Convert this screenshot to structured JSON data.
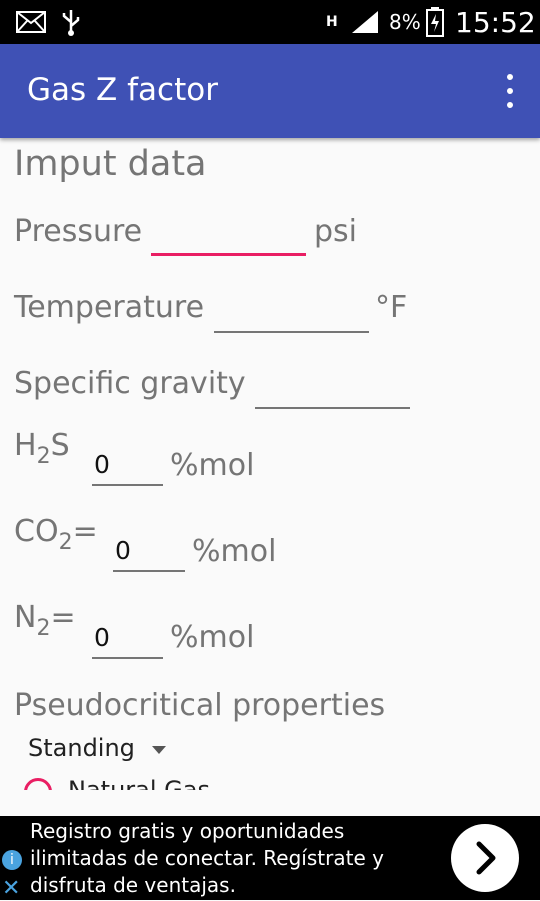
{
  "status_bar": {
    "time": "15:52",
    "battery_percent": "8%",
    "network": "H",
    "icons": [
      "mail-icon",
      "usb-icon",
      "signal-icon",
      "battery-icon"
    ]
  },
  "app_bar": {
    "title": "Gas Z factor",
    "menu_icon": "overflow-menu-icon"
  },
  "form": {
    "section_title": "Imput data",
    "pressure": {
      "label": "Pressure",
      "unit": "psi",
      "value": ""
    },
    "temperature": {
      "label": "Temperature",
      "unit": "°F",
      "value": ""
    },
    "specific_gravity": {
      "label": "Specific gravity",
      "value": ""
    },
    "h2s": {
      "label_main": "H",
      "label_sub": "2",
      "label_tail": "S",
      "value": "0",
      "unit": "%mol"
    },
    "co2": {
      "label_main": "CO",
      "label_sub": "2",
      "label_tail": "=",
      "value": "0",
      "unit": "%mol"
    },
    "n2": {
      "label_main": "N",
      "label_sub": "2",
      "label_tail": "=",
      "value": "0",
      "unit": "%mol"
    },
    "pseudocritical_title": "Pseudocritical properties",
    "method_select": {
      "value": "Standing"
    },
    "radio_label": "Natural Gas"
  },
  "ad": {
    "text": "Registro gratis y oportunidades ilimitadas de conectar. Regístrate y disfruta de ventajas.",
    "info_icon": "info-icon",
    "close_icon": "close-icon",
    "next_icon": "chevron-right-icon"
  },
  "colors": {
    "app_bar": "#3f51b5",
    "accent": "#e91e63"
  }
}
